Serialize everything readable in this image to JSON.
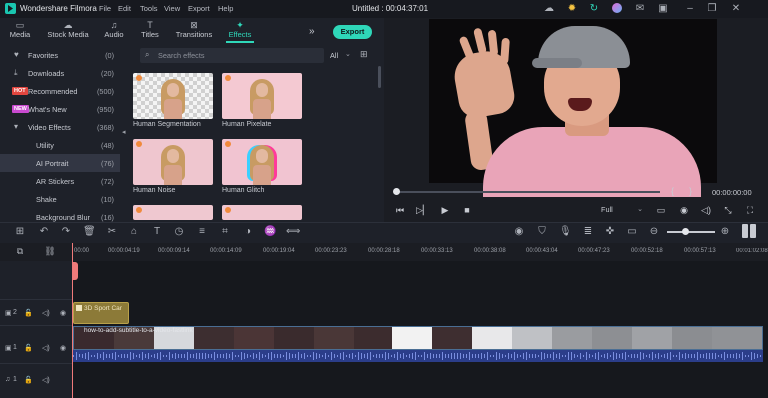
{
  "app": {
    "title": "Wondershare Filmora",
    "menu": [
      "File",
      "Edit",
      "Tools",
      "View",
      "Export",
      "Help"
    ],
    "project": "Untitled : 00:04:37:01"
  },
  "toolbar": {
    "tabs": [
      {
        "label": "Media",
        "icon": "folder-icon"
      },
      {
        "label": "Stock Media",
        "icon": "cloud-icon"
      },
      {
        "label": "Audio",
        "icon": "music-icon"
      },
      {
        "label": "Titles",
        "icon": "text-icon"
      },
      {
        "label": "Transitions",
        "icon": "transition-icon"
      },
      {
        "label": "Effects",
        "icon": "effects-icon",
        "active": true
      }
    ],
    "export_label": "Export"
  },
  "sidebar": {
    "items": [
      {
        "label": "Favorites",
        "count": "(0)",
        "icon": "heart-icon"
      },
      {
        "label": "Downloads",
        "count": "(20)",
        "icon": "download-icon"
      },
      {
        "label": "Recommended",
        "count": "(500)",
        "badge": "HOT"
      },
      {
        "label": "What's New",
        "count": "(950)",
        "badge": "NEW"
      },
      {
        "label": "Video Effects",
        "count": "(368)",
        "icon": "caret-down-icon"
      },
      {
        "label": "Utility",
        "count": "(48)"
      },
      {
        "label": "AI Portrait",
        "count": "(76)",
        "active": true
      },
      {
        "label": "AR Stickers",
        "count": "(72)"
      },
      {
        "label": "Shake",
        "count": "(10)"
      },
      {
        "label": "Background Blur",
        "count": "(16)"
      }
    ]
  },
  "effects": {
    "search_placeholder": "Search effects",
    "filter_value": "All",
    "items": [
      {
        "label": "Human Segmentation"
      },
      {
        "label": "Human Pixelate"
      },
      {
        "label": "Human Noise"
      },
      {
        "label": "Human Glitch"
      }
    ]
  },
  "player": {
    "timecode": "00:00:00:00",
    "quality": "Full"
  },
  "timeline": {
    "ticks": [
      "00:00",
      "00:00:04:19",
      "00:00:09:14",
      "00:00:14:09",
      "00:00:19:04",
      "00:00:23:23",
      "00:00:28:18",
      "00:00:33:13",
      "00:00:38:08",
      "00:00:43:04",
      "00:00:47:23",
      "00:00:52:18",
      "00:00:57:13",
      "00:01:02:08"
    ],
    "tracks": [
      {
        "label": "2",
        "icon": "video-track-icon"
      },
      {
        "label": "1",
        "icon": "video-track-icon"
      },
      {
        "label": "1",
        "icon": "audio-track-icon"
      }
    ],
    "title_clip": "3D Sport Car",
    "video_clip": "how-to-add-subtitle-to-a-video-fastlink"
  }
}
